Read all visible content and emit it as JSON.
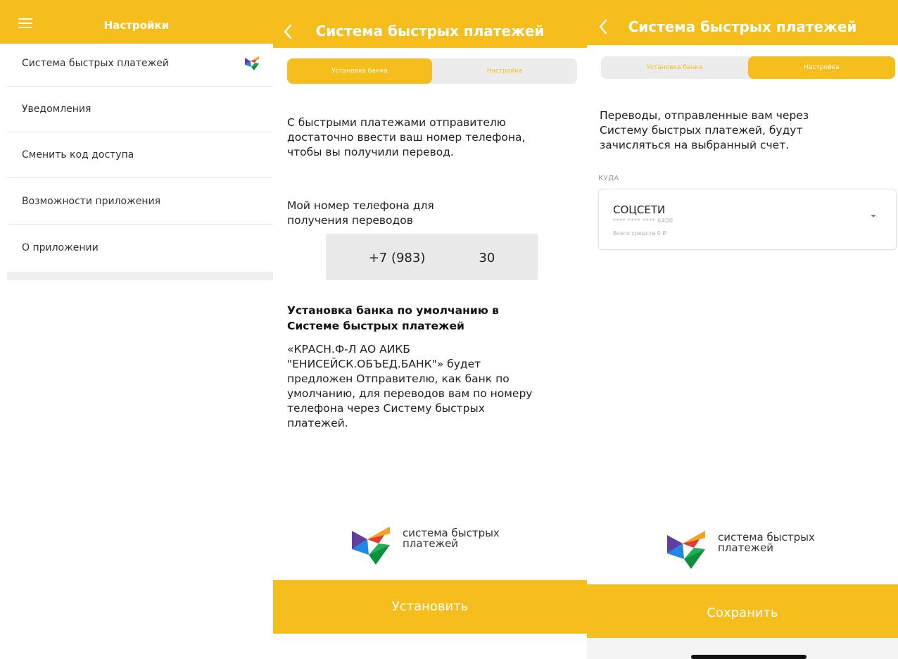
{
  "colors": {
    "accent": "#f6be1d",
    "sbp_red": "#e53935",
    "sbp_orange": "#f7a21b",
    "sbp_purple": "#5e3e9f",
    "sbp_blue": "#1e88e5",
    "sbp_green": "#1db154"
  },
  "settings": {
    "title": "Настройки",
    "menu_icon": "hamburger-icon",
    "items": [
      {
        "label": "Система быстрых платежей",
        "icon": "sbp-logo-icon"
      },
      {
        "label": "Уведомления"
      },
      {
        "label": "Сменить код доступа"
      },
      {
        "label": "Возможности приложения"
      },
      {
        "label": "О приложении"
      }
    ]
  },
  "bank_setup": {
    "title": "Система быстрых платежей",
    "back_icon": "chevron-left-icon",
    "tabs": [
      "Установка банка",
      "Настройка"
    ],
    "active_tab": 0,
    "intro": [
      "С быстрыми платежами отправителю",
      "достаточно ввести ваш номер телефона,",
      "чтобы вы получили перевод."
    ],
    "phone_label": [
      "Мой номер телефона для",
      "получения переводов"
    ],
    "phone_number": "+7 (983)",
    "phone_suffix": "30",
    "heading": [
      "Установка банка по умолчанию в",
      "Системе быстрых платежей"
    ],
    "description": [
      "«КРАСН.Ф-Л АО АИКБ",
      "\"ЕНИСЕЙСК.ОБЪЕД.БАНК\"» будет",
      "предложен Отправителю, как банк по",
      "умолчанию, для переводов вам по номеру",
      "телефона через Систему быстрых",
      "платежей."
    ],
    "logo_text": [
      "система быстрых",
      "платежей"
    ],
    "button": "Установить"
  },
  "settings_tab": {
    "title": "Система быстрых платежей",
    "back_icon": "chevron-left-icon",
    "tabs": [
      "Установка банка",
      "Настройка"
    ],
    "active_tab": 1,
    "intro": [
      "Переводы, отправленные вам через",
      "Систему быстрых платежей, будут",
      "зачисляться на выбранный счет."
    ],
    "to_label": "КУДА",
    "account": {
      "name": "СОЦСЕТИ",
      "mask": "**** **** **** 6400",
      "balance": "Всего средств 0 ₽"
    },
    "logo_text": [
      "система быстрых",
      "платежей"
    ],
    "button": "Сохранить"
  }
}
